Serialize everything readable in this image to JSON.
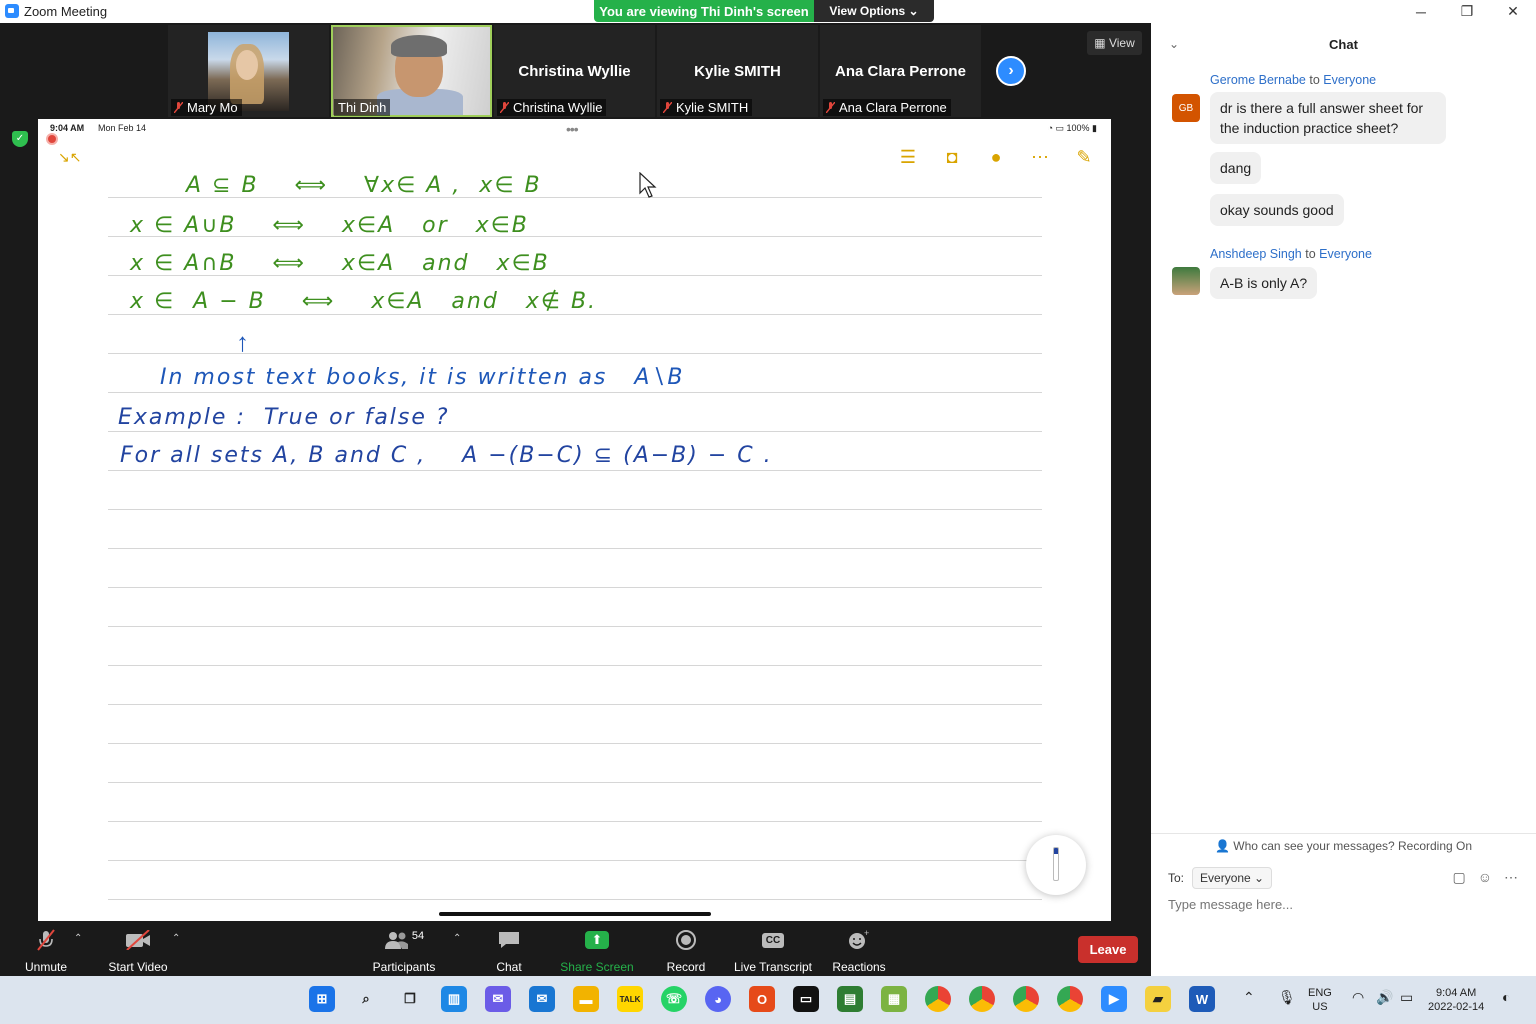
{
  "window": {
    "title": "Zoom Meeting",
    "minimize": "─",
    "restore": "❐",
    "close": "✕"
  },
  "banner": {
    "text": "You are viewing Thi Dinh's screen",
    "view_options": "View Options ⌄"
  },
  "gallery": {
    "participants": [
      {
        "name": "Mary Mo",
        "video": true,
        "muted": true
      },
      {
        "name": "Thi Dinh",
        "video": true,
        "muted": false,
        "active": true
      },
      {
        "name": "Christina Wyllie",
        "video": false,
        "muted": true
      },
      {
        "name": "Kylie SMITH",
        "video": false,
        "muted": true
      },
      {
        "name": "Ana Clara Perrone",
        "video": false,
        "muted": true
      }
    ],
    "view_label": "View"
  },
  "ipad": {
    "time": "9:04 AM",
    "date": "Mon Feb 14",
    "battery": "100%"
  },
  "notes": {
    "lines": [
      "A ⊆ B    ⟺    ∀x∈ A ,  x∈ B",
      "x ∈ A∪B    ⟺    x∈A   or   x∈B",
      "x ∈ A∩B    ⟺    x∈A   and   x∈B",
      "x ∈  A − B    ⟺    x∈A   and   x∉ B."
    ],
    "note_blue": "In most text books, it is written as   A∖B",
    "example": "Example :  True or false ?",
    "statement": "For all sets A, B and C ,    A −(B−C) ⊆ (A−B) − C ."
  },
  "toolbar": {
    "unmute": "Unmute",
    "start_video": "Start Video",
    "participants": "Participants",
    "participants_count": "54",
    "chat": "Chat",
    "share_screen": "Share Screen",
    "record": "Record",
    "live_transcript": "Live Transcript",
    "reactions": "Reactions",
    "leave": "Leave"
  },
  "chat": {
    "title": "Chat",
    "messages": [
      {
        "sender": "Gerome Bernabe",
        "to": "to",
        "recipient": "Everyone",
        "initials": "GB",
        "avatar_color": "#d35400",
        "texts": [
          "dr is there a full answer sheet for the induction practice sheet?",
          "dang",
          "okay sounds good"
        ]
      },
      {
        "sender": "Anshdeep Singh",
        "to": "to",
        "recipient": "Everyone",
        "initials": "",
        "texts": [
          "A-B is only A?"
        ]
      }
    ],
    "privacy": "Who can see your messages? Recording On",
    "to_label": "To:",
    "to_value": "Everyone",
    "placeholder": "Type message here..."
  },
  "taskbar": {
    "lang": "ENG",
    "region": "US",
    "time": "9:04 AM",
    "date": "2022-02-14"
  }
}
